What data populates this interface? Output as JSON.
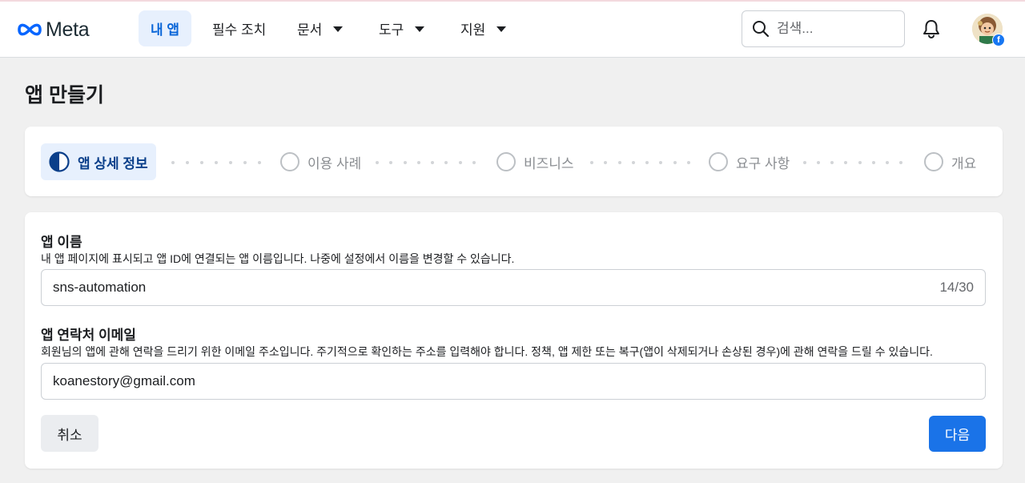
{
  "header": {
    "logo_text": "Meta",
    "nav": [
      {
        "label": "내 앱",
        "active": true
      },
      {
        "label": "필수 조치"
      },
      {
        "label": "문서",
        "dropdown": true
      },
      {
        "label": "도구",
        "dropdown": true
      },
      {
        "label": "지원",
        "dropdown": true
      }
    ],
    "search_placeholder": "검색..."
  },
  "page": {
    "title": "앱 만들기"
  },
  "stepper": {
    "steps": [
      {
        "label": "앱 상세 정보",
        "state": "current"
      },
      {
        "label": "이용 사례",
        "state": "pending"
      },
      {
        "label": "비즈니스",
        "state": "pending"
      },
      {
        "label": "요구 사항",
        "state": "pending"
      },
      {
        "label": "개요",
        "state": "pending"
      }
    ]
  },
  "form": {
    "app_name": {
      "title": "앱 이름",
      "description": "내 앱 페이지에 표시되고 앱 ID에 연결되는 앱 이름입니다. 나중에 설정에서 이름을 변경할 수 있습니다.",
      "value": "sns-automation",
      "counter": "14/30"
    },
    "contact_email": {
      "title": "앱 연락처 이메일",
      "description": "회원님의 앱에 관해 연락을 드리기 위한 이메일 주소입니다. 주기적으로 확인하는 주소를 입력해야 합니다. 정책, 앱 제한 또는 복구(앱이 삭제되거나 손상된 경우)에 관해 연락을 드릴 수 있습니다.",
      "value": "koanestory@gmail.com"
    },
    "cancel_label": "취소",
    "next_label": "다음"
  },
  "colors": {
    "accent": "#1a73e8",
    "active_tab_bg": "#e7f0fd",
    "page_bg": "#f0f0f0"
  },
  "icons": {
    "logo": "meta-infinity-logo",
    "search": "search-icon",
    "bell": "bell-icon",
    "avatar_badge": "facebook-icon"
  }
}
